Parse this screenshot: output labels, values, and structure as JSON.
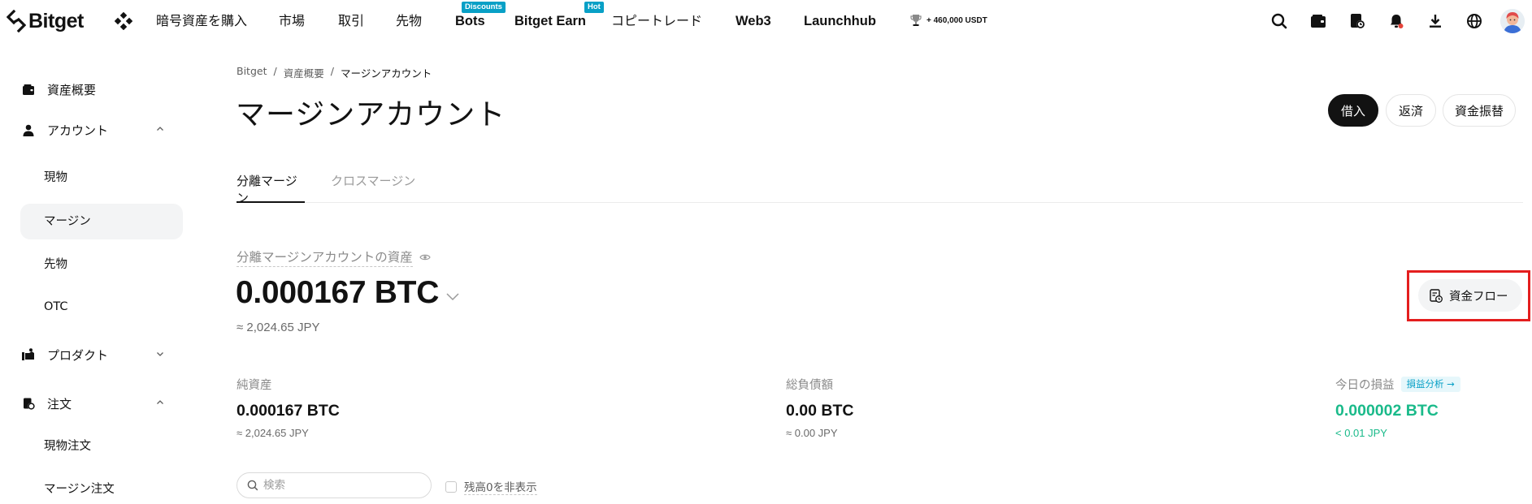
{
  "brand": {
    "name": "Bitget"
  },
  "nav": {
    "items": [
      {
        "label": "暗号資産を購入"
      },
      {
        "label": "市場"
      },
      {
        "label": "取引"
      },
      {
        "label": "先物"
      },
      {
        "label": "Bots",
        "badge": "Discounts"
      },
      {
        "label": "Bitget Earn",
        "badge": "Hot"
      },
      {
        "label": "コピートレード"
      },
      {
        "label": "Web3"
      },
      {
        "label": "Launchhub"
      }
    ],
    "promo": "+ 460,000 USDT",
    "right_icons": [
      "search-icon",
      "wallet-icon",
      "orders-icon",
      "bell-icon",
      "download-icon",
      "globe-icon"
    ]
  },
  "sidebar": {
    "overview": "資産概要",
    "account": "アカウント",
    "account_items": [
      "現物",
      "マージン",
      "先物",
      "OTC"
    ],
    "product": "プロダクト",
    "orders": "注文",
    "order_items": [
      "現物注文",
      "マージン注文"
    ],
    "active_item": "マージン"
  },
  "breadcrumb": [
    "Bitget",
    "資産概要",
    "マージンアカウント"
  ],
  "page": {
    "title": "マージンアカウント",
    "buttons": {
      "borrow": "借入",
      "repay": "返済",
      "transfer": "資金振替"
    }
  },
  "tabs": [
    {
      "label": "分離マージン",
      "active": true
    },
    {
      "label": "クロスマージン",
      "active": false
    }
  ],
  "assets": {
    "label": "分離マージンアカウントの資産",
    "value": "0.000167 BTC",
    "approx": "≈ 2,024.65 JPY",
    "flow_button": "資金フロー"
  },
  "stats": {
    "net": {
      "label": "純資産",
      "value": "0.000167 BTC",
      "sub": "≈ 2,024.65 JPY"
    },
    "debt": {
      "label": "総負債額",
      "value": "0.00 BTC",
      "sub": "≈ 0.00 JPY"
    },
    "pnl": {
      "label": "今日の損益",
      "badge": "損益分析 →",
      "value": "0.000002 BTC",
      "sub": "< 0.01 JPY"
    }
  },
  "filter": {
    "search_placeholder": "検索",
    "hide_zero": "残高0を非表示"
  },
  "colors": {
    "accent_blue": "#08a0c6",
    "profit_green": "#1aba8a",
    "highlight_red": "#e41e1e",
    "dark": "#121212"
  }
}
